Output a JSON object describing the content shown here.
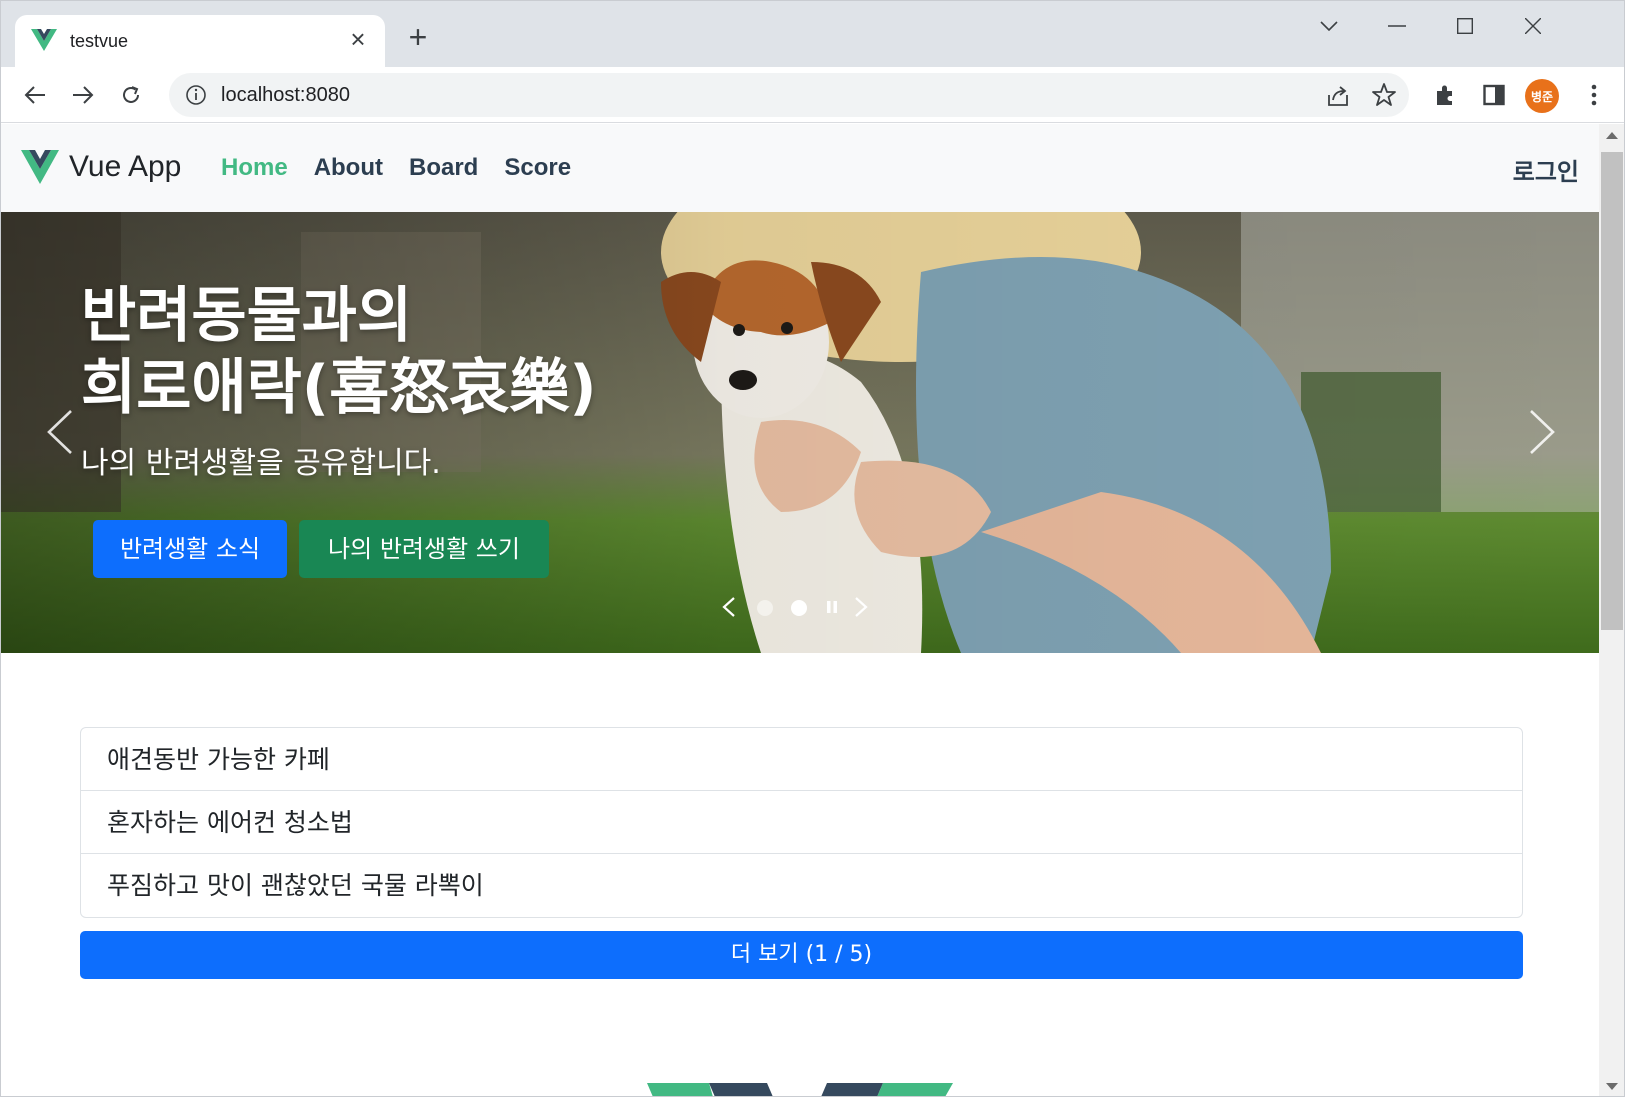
{
  "browser": {
    "tab_title": "testvue",
    "url": "localhost:8080",
    "profile_initials": "병준"
  },
  "navbar": {
    "brand": "Vue App",
    "links": [
      {
        "label": "Home",
        "active": true
      },
      {
        "label": "About",
        "active": false
      },
      {
        "label": "Board",
        "active": false
      },
      {
        "label": "Score",
        "active": false
      }
    ],
    "login": "로그인"
  },
  "hero": {
    "title_line1": "반려동물과의",
    "title_line2": "희로애락(喜怒哀樂)",
    "subtitle": "나의 반려생활을 공유합니다.",
    "primary_button": "반려생활 소식",
    "secondary_button": "나의 반려생활 쓰기",
    "slide_count": 2,
    "active_slide": 2
  },
  "list": {
    "items": [
      "애견동반 가능한 카페",
      "혼자하는 에어컨 청소법",
      "푸짐하고 맛이 괜찮았던 국물 라뽁이"
    ],
    "more_button": "더 보기 (1 / 5)"
  },
  "colors": {
    "vue_green": "#42b983",
    "vue_dark": "#35495e",
    "primary": "#0d6efd",
    "success": "#198754",
    "nav_text": "#2c3e50",
    "profile": "#e8711a"
  }
}
